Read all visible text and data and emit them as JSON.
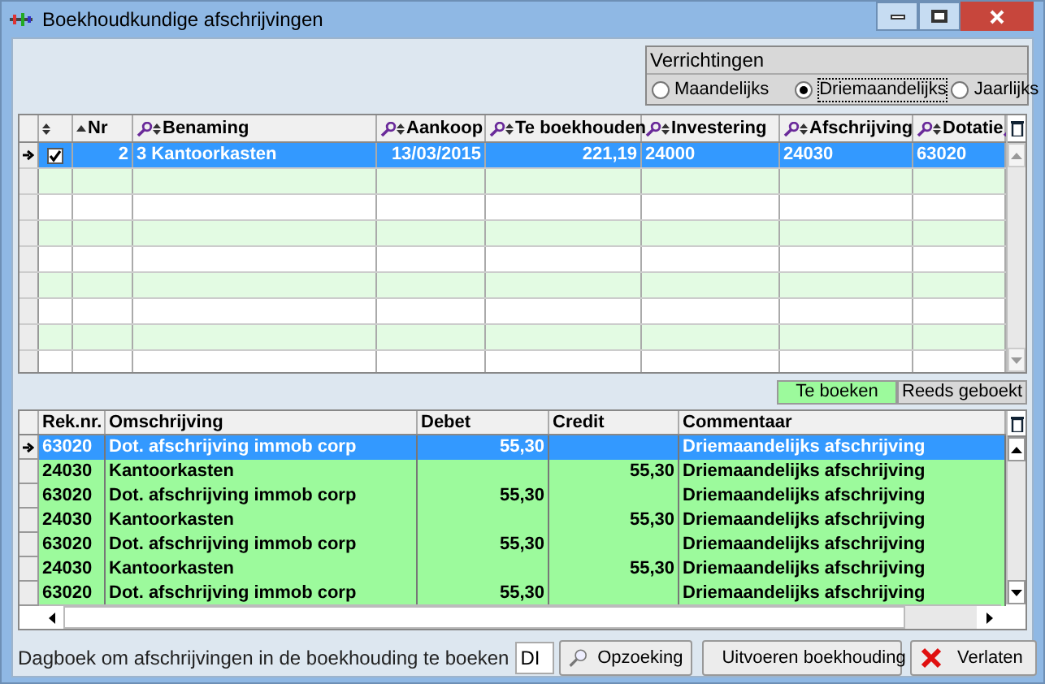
{
  "window": {
    "title": "Boekhoudkundige afschrijvingen"
  },
  "operations": {
    "title": "Verrichtingen",
    "options": [
      {
        "label": "Maandelijks",
        "selected": false
      },
      {
        "label": "Driemaandelijks",
        "selected": true
      },
      {
        "label": "Jaarlijks",
        "selected": false
      }
    ]
  },
  "assets_table": {
    "columns": [
      "Nr",
      "Benaming",
      "Aankoop",
      "Te boekhouden",
      "Investering",
      "Afschrijving",
      "Dotatie"
    ],
    "rows": [
      {
        "selected": true,
        "checked": true,
        "cells": [
          "2",
          "3 Kantoorkasten",
          "13/03/2015",
          "221,19",
          "24000",
          "24030",
          "63020"
        ]
      }
    ]
  },
  "tabs": [
    {
      "label": "Te boeken",
      "selected": true
    },
    {
      "label": "Reeds geboekt",
      "selected": false
    }
  ],
  "entries_table": {
    "columns": [
      "Rek.nr.",
      "Omschrijving",
      "Debet",
      "Credit",
      "Commentaar"
    ],
    "rows": [
      {
        "selected": true,
        "cells": [
          "63020",
          "Dot. afschrijving immob corp",
          "55,30",
          "",
          "Driemaandelijks afschrijving"
        ]
      },
      {
        "selected": false,
        "cells": [
          "24030",
          "Kantoorkasten",
          "",
          "55,30",
          "Driemaandelijks afschrijving"
        ]
      },
      {
        "selected": false,
        "cells": [
          "63020",
          "Dot. afschrijving immob corp",
          "55,30",
          "",
          "Driemaandelijks afschrijving"
        ]
      },
      {
        "selected": false,
        "cells": [
          "24030",
          "Kantoorkasten",
          "",
          "55,30",
          "Driemaandelijks afschrijving"
        ]
      },
      {
        "selected": false,
        "cells": [
          "63020",
          "Dot. afschrijving immob corp",
          "55,30",
          "",
          "Driemaandelijks afschrijving"
        ]
      },
      {
        "selected": false,
        "cells": [
          "24030",
          "Kantoorkasten",
          "",
          "55,30",
          "Driemaandelijks afschrijving"
        ]
      },
      {
        "selected": false,
        "cells": [
          "63020",
          "Dot. afschrijving immob corp",
          "55,30",
          "",
          "Driemaandelijks afschrijving"
        ]
      }
    ]
  },
  "footer": {
    "label": "Dagboek om afschrijvingen in de boekhouding te boeken",
    "journal": "DI",
    "buttons": [
      {
        "kind": "search",
        "label": "Opzoeking"
      },
      {
        "kind": "scale",
        "label": "Uitvoeren boekhouding"
      },
      {
        "kind": "close",
        "label": "Verlaten"
      }
    ]
  }
}
